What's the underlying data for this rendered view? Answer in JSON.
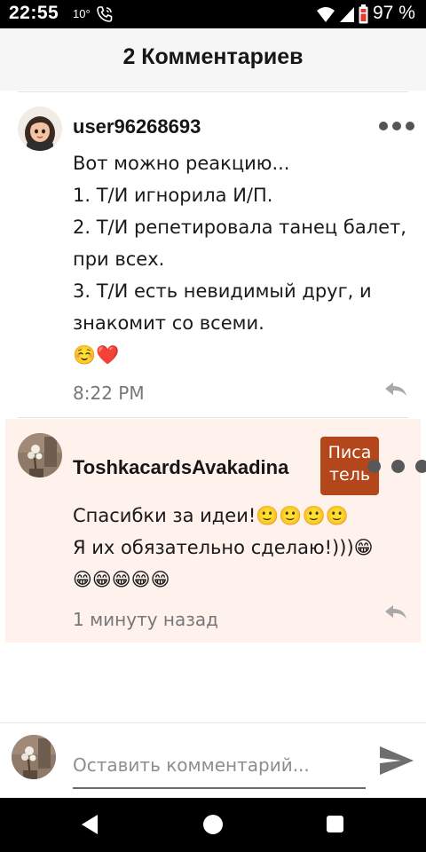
{
  "status_bar": {
    "time": "22:55",
    "temperature": "10°",
    "battery_percent": "97 %"
  },
  "header": {
    "title": "2 Комментариев"
  },
  "comments": [
    {
      "username": "user96268693",
      "body": "Вот можно реакцию...\n1. Т/И игнорила И/П.\n2. Т/И репетировала танец балет, при всех.\n3. Т/И есть невидимый друг, и знакомит со всеми.\n☺️❤️",
      "timestamp": "8:22 PM",
      "avatar_icon": "cartoon-girl-avatar"
    },
    {
      "username": "ToshkacardsAvakadina",
      "badge": "Писа\nтель",
      "body": "Спасибки за идеи!🙂🙂🙂🙂\nЯ их обязательно сделаю!)))😁\n😁😁😁😁😁",
      "timestamp": "1 минуту назад",
      "highlight_color": "#fff1ec",
      "badge_color": "#b3471b",
      "avatar_icon": "flowers-photo-avatar"
    }
  ],
  "composer": {
    "placeholder": "Оставить комментарий...",
    "send_icon": "send-arrow-icon"
  },
  "nav_bar": {
    "icons": [
      "back-triangle-icon",
      "home-circle-icon",
      "recents-square-icon"
    ]
  }
}
